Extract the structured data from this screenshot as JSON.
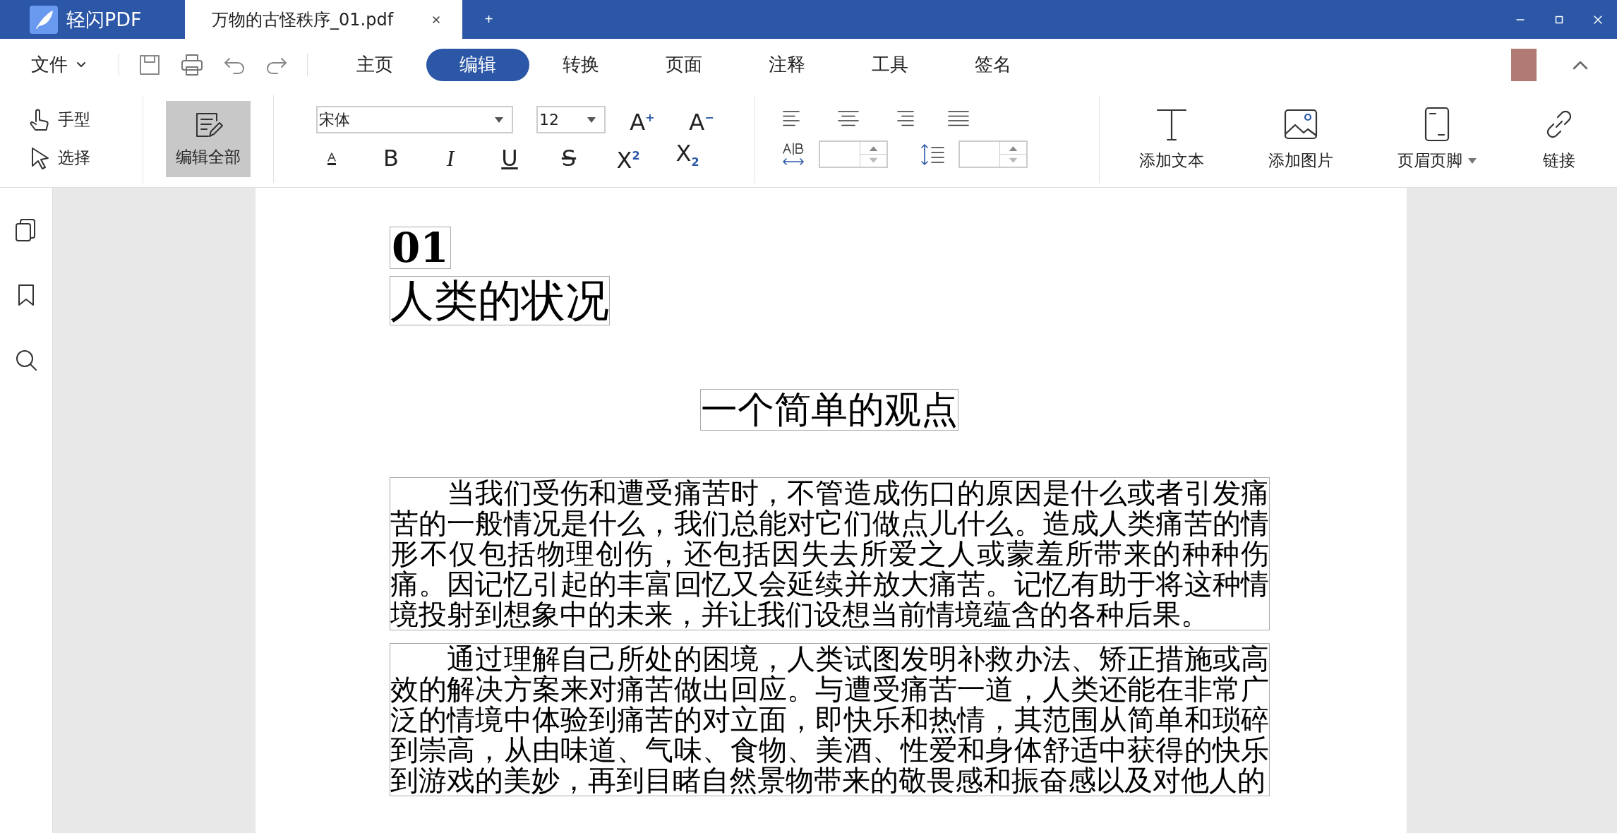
{
  "title_bar": {
    "app_name": "轻闪PDF",
    "tabs": [
      {
        "label": "万物的古怪秩序_01.pdf",
        "selected": true
      }
    ],
    "new_tab": "+"
  },
  "menu": {
    "file_menu": "文件",
    "ribbon_tabs": [
      {
        "label": "主页",
        "selected": false
      },
      {
        "label": "编辑",
        "selected": true
      },
      {
        "label": "转换",
        "selected": false
      },
      {
        "label": "页面",
        "selected": false
      },
      {
        "label": "注释",
        "selected": false
      },
      {
        "label": "工具",
        "selected": false
      },
      {
        "label": "签名",
        "selected": false
      }
    ]
  },
  "toolbar": {
    "modes": [
      {
        "label": "手型",
        "kind": "hand"
      },
      {
        "label": "选择",
        "kind": "select"
      }
    ],
    "edit_all": {
      "label": "编辑全部",
      "selected": true
    },
    "font": {
      "family": "宋体",
      "size": "12"
    },
    "size_buttons": [
      {
        "label": "A$^{+}$",
        "kind": "grow"
      },
      {
        "label": "A$^{−}$",
        "kind": "shrink"
      }
    ],
    "format_buttons": [
      {
        "label": "B",
        "kind": "bold"
      },
      {
        "label": "I",
        "kind": "italic"
      },
      {
        "label": "U",
        "kind": "underline"
      },
      {
        "label": "S",
        "kind": "strike"
      },
      {
        "label": "X$^{2}$",
        "kind": "sup"
      },
      {
        "label": "X$_{2}$",
        "kind": "sub"
      }
    ],
    "align_buttons": [
      {
        "kind": "left"
      },
      {
        "kind": "center"
      },
      {
        "kind": "right"
      },
      {
        "kind": "justify"
      }
    ],
    "insert_tools": [
      {
        "label": "添加文本",
        "kind": "text",
        "dropdown": false
      },
      {
        "label": "添加图片",
        "kind": "image",
        "dropdown": false
      },
      {
        "label": "页眉页脚",
        "kind": "header",
        "dropdown": true
      },
      {
        "label": "链接",
        "kind": "link",
        "dropdown": false
      }
    ]
  },
  "sidebar": {
    "items": [
      {
        "kind": "pages"
      },
      {
        "kind": "bookmark"
      },
      {
        "kind": "search"
      }
    ]
  },
  "document": {
    "number": "01",
    "title": "人类的状况",
    "subtitle": "一个简单的观点",
    "paragraphs": [
      "当我们受伤和遭受痛苦时，不管造成伤口的原因是什么或者引发痛苦的一般情况是什么，我们总能对它们做点儿什么。造成人类痛苦的情形不仅包括物理创伤，还包括因失去所爱之人或蒙羞所带来的种种伤痛。因记忆引起的丰富回忆又会延续并放大痛苦。记忆有助于将这种情境投射到想象中的未来，并让我们设想当前情境蕴含的各种后果。",
      "通过理解自己所处的困境，人类试图发明补救办法、矫正措施或高效的解决方案来对痛苦做出回应。与遭受痛苦一道，人类还能在非常广泛的情境中体验到痛苦的对立面，即快乐和热情，其范围从简单和琐碎到崇高，从由味道、气味、食物、美酒、性爱和身体舒适中获得的快乐到游戏的美妙，再到目睹自然景物带来的敬畏感和振奋感以及对他人的"
    ]
  }
}
